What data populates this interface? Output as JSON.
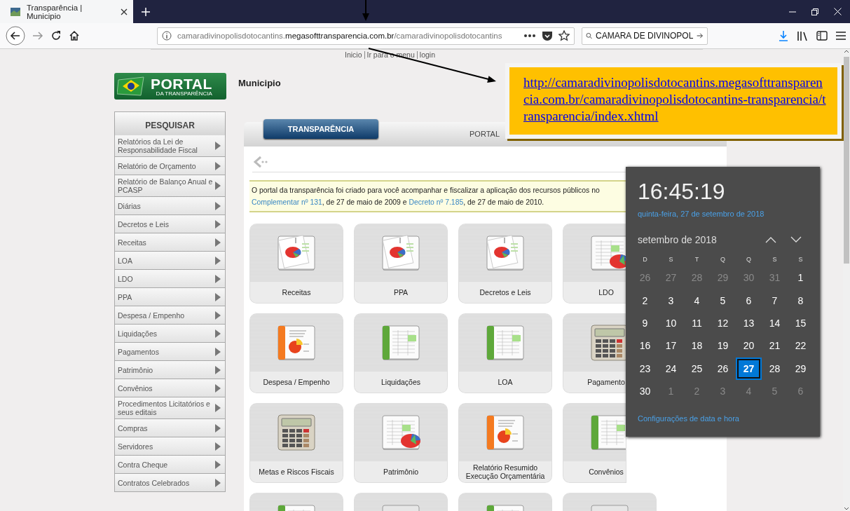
{
  "browser": {
    "tab_title": "Transparência | Municipio",
    "url": {
      "subdomain": "camaradivinopolisdotocantins.",
      "domain": "megasofttransparencia.com.br",
      "path": "/camaradivinopolisdotocantins"
    },
    "search_value": "CAMARA DE DIVINOPOL"
  },
  "top_links": [
    "Inicio",
    "Ir para o menu",
    "login"
  ],
  "logo": {
    "title": "PORTAL",
    "subtitle": "DA TRANSPARÊNCIA"
  },
  "page_title": "Municipio",
  "sidebar": {
    "header": "PESQUISAR",
    "items": [
      "Relatórios da Lei de Responsabilidade Fiscal",
      "Relatório de Orçamento",
      "Relatório de Balanço Anual e PCASP",
      "Diárias",
      "Decretos e Leis",
      "Receitas",
      "LOA",
      "LDO",
      "PPA",
      "Despesa / Empenho",
      "Liquidações",
      "Pagamentos",
      "Patrimônio",
      "Convênios",
      "Procedimentos Licitatórios e seus editais",
      "Compras",
      "Servidores",
      "Contra Cheque",
      "Contratos Celebrados"
    ]
  },
  "tabs": [
    {
      "label": "TRANSPARÊNCIA",
      "selected": true
    },
    {
      "label": "PORTAL",
      "selected": false
    }
  ],
  "notice": {
    "line_1": "O portal da transparência foi criado para você acompanhar e fiscalizar a aplicação dos recursos públicos no",
    "line_2": [
      {
        "text": "Complementar nº 131",
        "kind": "link"
      },
      {
        "text": ", de 27 de maio de 2009 e ",
        "kind": "text"
      },
      {
        "text": "Decreto nº 7.185",
        "kind": "link"
      },
      {
        "text": ", de 27 de maio de 2010.",
        "kind": "text"
      }
    ]
  },
  "tiles": [
    {
      "label": "Receitas",
      "kind": "documents"
    },
    {
      "label": "PPA",
      "kind": "documents"
    },
    {
      "label": "Decretos e Leis",
      "kind": "documents"
    },
    {
      "label": "LDO",
      "kind": "chart"
    },
    {
      "label": "Despesa / Empenho",
      "kind": "report"
    },
    {
      "label": "Liquidações",
      "kind": "ledger"
    },
    {
      "label": "LOA",
      "kind": "ledger"
    },
    {
      "label": "Pagamento",
      "kind": "calculator"
    },
    {
      "label": "Metas e Riscos Fiscais",
      "kind": "calculator"
    },
    {
      "label": "Patrimônio",
      "kind": "chart"
    },
    {
      "label": "Relatório Resumido Execução Orçamentária",
      "kind": "report"
    },
    {
      "label": "Convênios",
      "kind": "ledger"
    },
    {
      "kind": "ledger"
    },
    {
      "kind": "profile"
    },
    {
      "kind": "ledger"
    },
    {
      "kind": "profile"
    }
  ],
  "clock": {
    "time": "16:45:19",
    "date": "quinta-feira, 27 de setembro de 2018",
    "month": "setembro de 2018",
    "weekdays": [
      "D",
      "S",
      "T",
      "Q",
      "Q",
      "S",
      "S"
    ],
    "days": [
      {
        "label": "26",
        "dimmed": true,
        "selected": false
      },
      {
        "label": "27",
        "dimmed": true,
        "selected": false
      },
      {
        "label": "28",
        "dimmed": true,
        "selected": false
      },
      {
        "label": "29",
        "dimmed": true,
        "selected": false
      },
      {
        "label": "30",
        "dimmed": true,
        "selected": false
      },
      {
        "label": "31",
        "dimmed": true,
        "selected": false
      },
      {
        "label": "1",
        "dimmed": false,
        "selected": false
      },
      {
        "label": "2",
        "dimmed": false,
        "selected": false
      },
      {
        "label": "3",
        "dimmed": false,
        "selected": false
      },
      {
        "label": "4",
        "dimmed": false,
        "selected": false
      },
      {
        "label": "5",
        "dimmed": false,
        "selected": false
      },
      {
        "label": "6",
        "dimmed": false,
        "selected": false
      },
      {
        "label": "7",
        "dimmed": false,
        "selected": false
      },
      {
        "label": "8",
        "dimmed": false,
        "selected": false
      },
      {
        "label": "9",
        "dimmed": false,
        "selected": false
      },
      {
        "label": "10",
        "dimmed": false,
        "selected": false
      },
      {
        "label": "11",
        "dimmed": false,
        "selected": false
      },
      {
        "label": "12",
        "dimmed": false,
        "selected": false
      },
      {
        "label": "13",
        "dimmed": false,
        "selected": false
      },
      {
        "label": "14",
        "dimmed": false,
        "selected": false
      },
      {
        "label": "15",
        "dimmed": false,
        "selected": false
      },
      {
        "label": "16",
        "dimmed": false,
        "selected": false
      },
      {
        "label": "17",
        "dimmed": false,
        "selected": false
      },
      {
        "label": "18",
        "dimmed": false,
        "selected": false
      },
      {
        "label": "19",
        "dimmed": false,
        "selected": false
      },
      {
        "label": "20",
        "dimmed": false,
        "selected": false
      },
      {
        "label": "21",
        "dimmed": false,
        "selected": false
      },
      {
        "label": "22",
        "dimmed": false,
        "selected": false
      },
      {
        "label": "23",
        "dimmed": false,
        "selected": false
      },
      {
        "label": "24",
        "dimmed": false,
        "selected": false
      },
      {
        "label": "25",
        "dimmed": false,
        "selected": false
      },
      {
        "label": "26",
        "dimmed": false,
        "selected": false
      },
      {
        "label": "27",
        "dimmed": false,
        "selected": true
      },
      {
        "label": "28",
        "dimmed": false,
        "selected": false
      },
      {
        "label": "29",
        "dimmed": false,
        "selected": false
      },
      {
        "label": "30",
        "dimmed": false,
        "selected": false
      },
      {
        "label": "1",
        "dimmed": true,
        "selected": false
      },
      {
        "label": "2",
        "dimmed": true,
        "selected": false
      },
      {
        "label": "3",
        "dimmed": true,
        "selected": false
      },
      {
        "label": "4",
        "dimmed": true,
        "selected": false
      },
      {
        "label": "5",
        "dimmed": true,
        "selected": false
      },
      {
        "label": "6",
        "dimmed": true,
        "selected": false
      }
    ],
    "settings_link": "Configurações de data e hora"
  },
  "callout": {
    "link": "http://camaradivinopolisdotocantins.megasofttransparencia.com.br/camaradivinopolisdotocantins-transparencia/transparencia/index.xhtml"
  }
}
